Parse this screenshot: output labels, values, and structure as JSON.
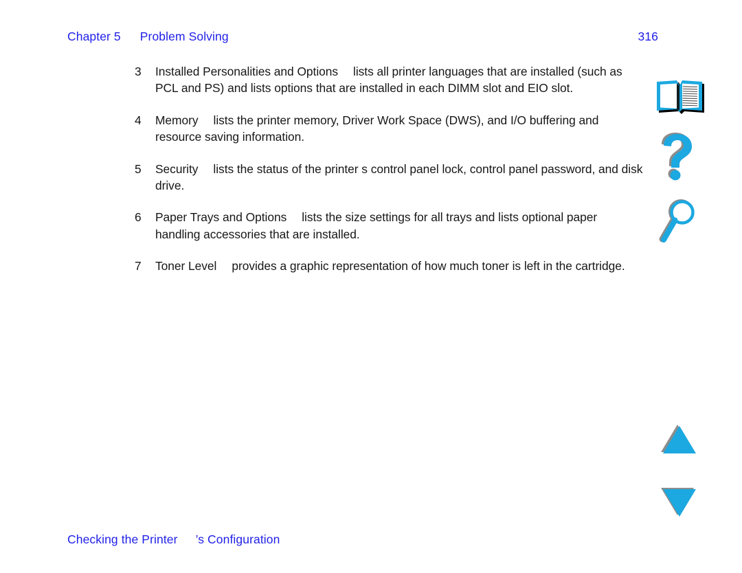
{
  "colors": {
    "link_blue": "#1f1fe8",
    "body_text": "#171717",
    "icon_cyan": "#1ca8e0",
    "icon_shadow": "#808080",
    "page_background": "#ffffff"
  },
  "header": {
    "chapter_label": "Chapter 5",
    "chapter_title": "Problem Solving",
    "page_number": "316"
  },
  "content": {
    "items": [
      {
        "number": "3",
        "text_before_dash": "Installed Personalities and Options",
        "text_after_dash": "lists all printer languages that are installed (such as PCL and PS) and lists options that are installed in each DIMM slot and EIO slot."
      },
      {
        "number": "4",
        "text_before_dash": "Memory",
        "text_after_dash": "lists the printer memory, Driver Work Space (DWS), and I/O buffering and resource saving information."
      },
      {
        "number": "5",
        "text_before_dash": "Security",
        "text_after_dash": "lists the status of the printer s control panel lock, control panel password, and disk drive."
      },
      {
        "number": "6",
        "text_before_dash": "Paper Trays and Options",
        "text_after_dash": "lists the size settings for all trays and lists optional paper handling accessories that are installed."
      },
      {
        "number": "7",
        "text_before_dash": "Toner Level",
        "text_after_dash": "provides a graphic representation of how much toner is left in the cartridge."
      }
    ]
  },
  "footer": {
    "text_before_gap": "Checking the Printer",
    "text_after_gap": "’s Configuration"
  },
  "icon_rail": {
    "book": "book-icon",
    "help": "question-mark-icon",
    "search": "magnifier-icon",
    "previous": "triangle-up-icon",
    "next": "triangle-down-icon"
  }
}
